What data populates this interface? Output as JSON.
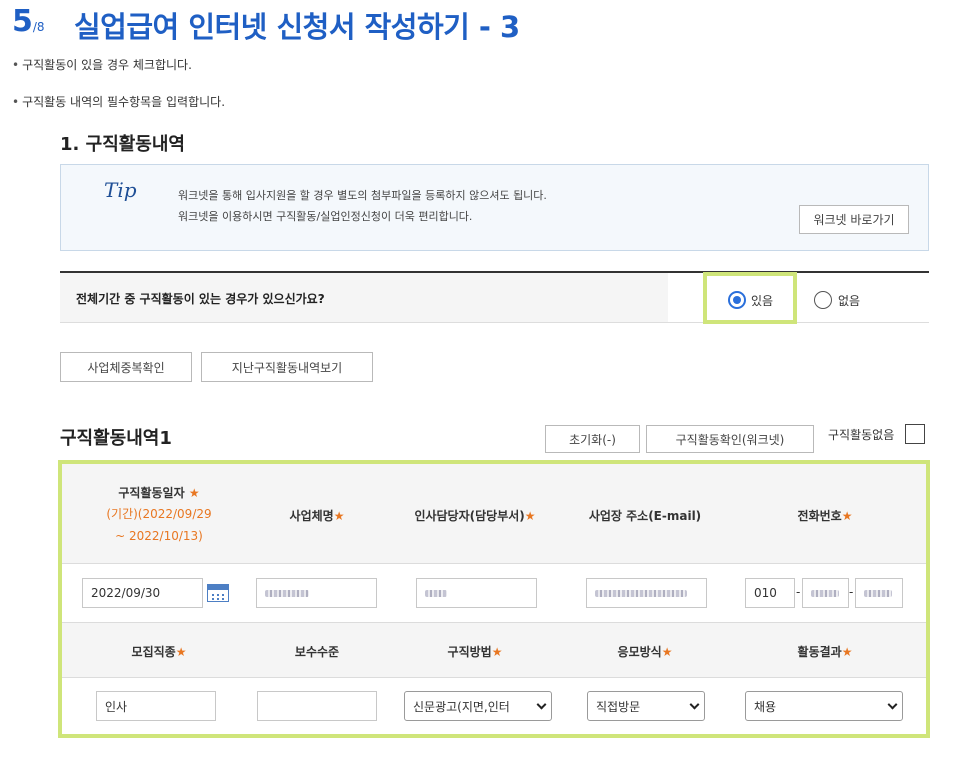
{
  "header": {
    "step_current": "5",
    "step_total": "/8",
    "title": "실업급여 인터넷 신청서 작성하기 - 3"
  },
  "bullets": [
    "구직활동이 있을 경우 체크합니다.",
    "구직활동 내역의 필수항목을 입력합니다."
  ],
  "section": {
    "title": "1. 구직활동내역"
  },
  "tip": {
    "logo": "Tip",
    "line1": "워크넷을 통해 입사지원을 할 경우 별도의 첨부파일을 등록하지 않으셔도 됩니다.",
    "line2": "워크넷을 이용하시면 구직활동/실업인정신청이 더욱 편리합니다.",
    "button": "워크넷 바로가기"
  },
  "question": {
    "text": "전체기간 중 구직활동이 있는 경우가 있으신가요?",
    "option_yes": "있음",
    "option_no": "없음",
    "selected": "있음"
  },
  "actions": {
    "dup_check": "사업체중복확인",
    "history": "지난구직활동내역보기"
  },
  "activity": {
    "title": "구직활동내역1",
    "reset_button": "초기화(-)",
    "confirm_button": "구직활동확인(워크넷)",
    "none_label": "구직활동없음",
    "none_checked": false,
    "headers1": {
      "date": "구직활동일자",
      "period_line1": "(기간)(2022/09/29",
      "period_line2": "~ 2022/10/13)",
      "company": "사업체명",
      "manager": "인사담당자(담당부서)",
      "address": "사업장 주소(E-mail)",
      "phone": "전화번호"
    },
    "star": "★",
    "values1": {
      "date": "2022/09/30",
      "phone_prefix": "010",
      "dash": "-"
    },
    "headers2": {
      "job_type": "모집직종",
      "salary": "보수수준",
      "method": "구직방법",
      "apply": "응모방식",
      "result": "활동결과"
    },
    "values2": {
      "job_type": "인사",
      "salary": "",
      "method": "신문광고(지면,인터",
      "apply": "직접방문",
      "result": "채용"
    }
  },
  "colors": {
    "title_blue": "#1f5fc4",
    "highlight": "#cfe57a",
    "required_star": "#e87722",
    "radio_selected": "#2a6fdb"
  }
}
